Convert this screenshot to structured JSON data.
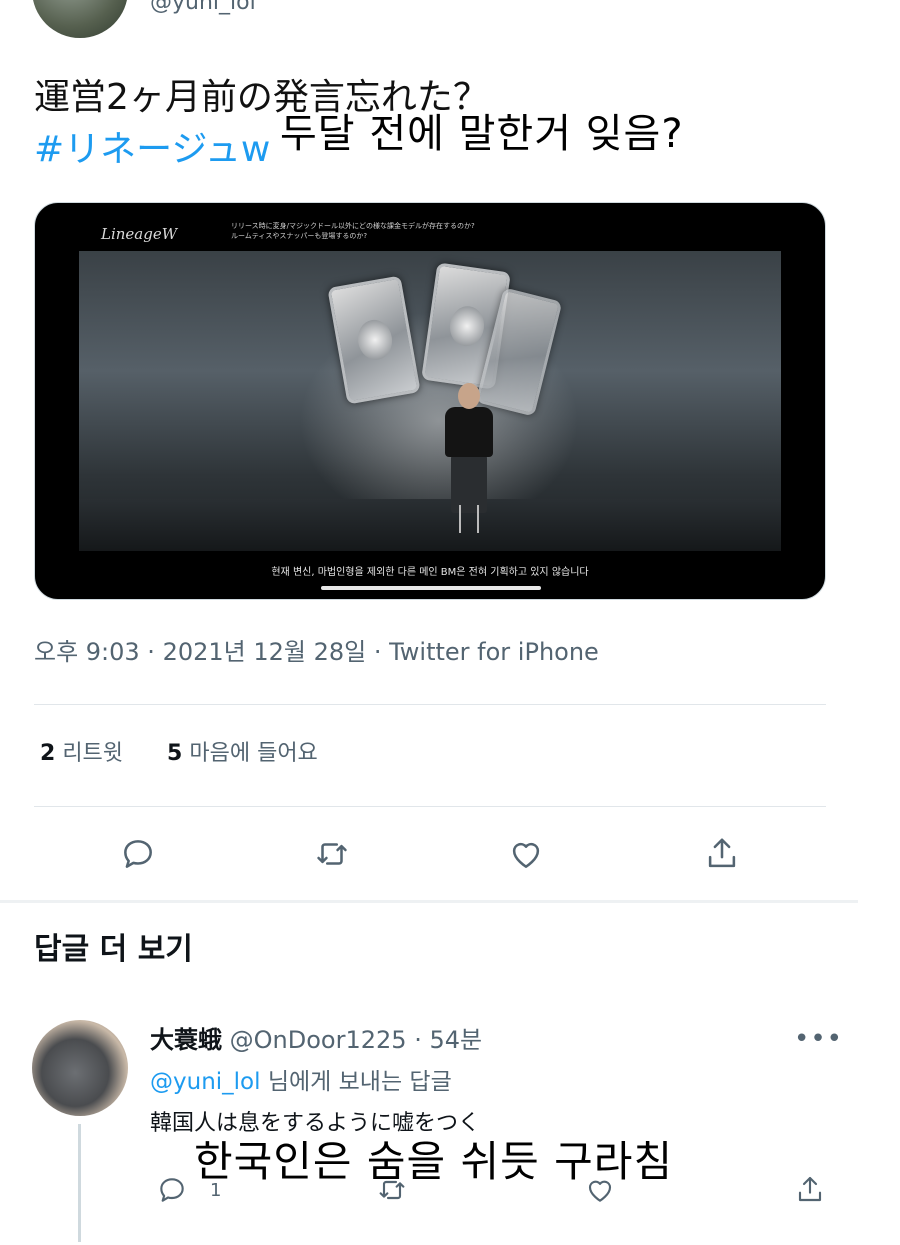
{
  "author": {
    "handle": "@yuni_lol"
  },
  "tweet": {
    "text": "運営2ヶ月前の発言忘れた？",
    "hashtag": "#リネージュw",
    "caption_overlay": "두달 전에 말한거 잊음?"
  },
  "media": {
    "logo": "LineageW",
    "top_text_line1": "リリース時に変身/マジックドール以外にどの様な課金モデルが存在するのか?",
    "top_text_line2": "ルームティスやスナッパーも登場するのか?",
    "subtitle": "현재 변신, 마법인형을 제외한 다른 메인 BM은 전혀 기획하고 있지 않습니다"
  },
  "meta": {
    "line": "오후 9:03 · 2021년 12월 28일 · Twitter for iPhone"
  },
  "stats": {
    "retweets_count": "2",
    "retweets_label": "리트윗",
    "likes_count": "5",
    "likes_label": "마음에 들어요"
  },
  "actions": [
    "reply-icon",
    "retweet-icon",
    "like-icon",
    "share-icon"
  ],
  "section": {
    "more_replies": "답글 더 보기"
  },
  "reply": {
    "name": "大蓑蛾",
    "handle": "@OnDoor1225",
    "time": "· 54분",
    "replying_mention": "@yuni_lol",
    "replying_suffix": " 님에게 보내는 답글",
    "text": "韓国人は息をするように嘘をつく",
    "caption_overlay": "한국인은 숨을 쉬듯 구라침",
    "reply_count": "1",
    "more": "•••"
  },
  "colors": {
    "accent": "#1d9bf0",
    "secondary_text": "#536471",
    "primary_text": "#0f1419"
  }
}
